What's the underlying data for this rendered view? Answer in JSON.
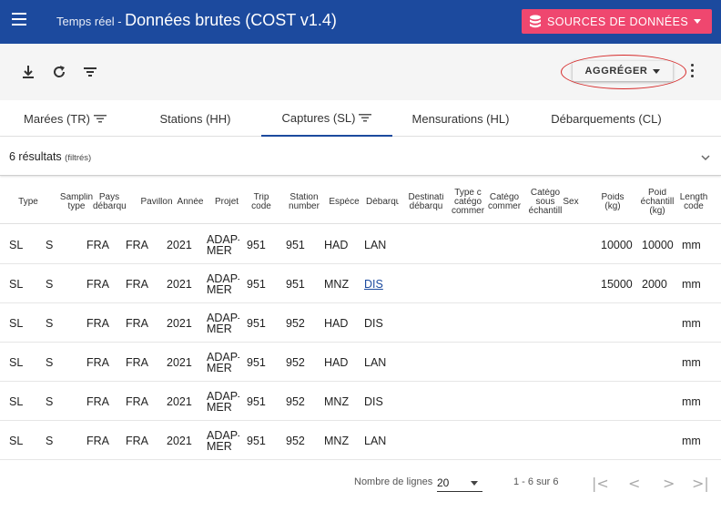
{
  "header": {
    "subtitle": "Temps réel -",
    "title": "Données brutes (COST v1.4)",
    "sources_label": "SOURCES DE DONNÉES",
    "accent": "#1c4a9e",
    "sources_color": "#ef476f"
  },
  "toolbar": {
    "icons": [
      "download-icon",
      "refresh-icon",
      "filter-icon"
    ],
    "aggregate_label": "AGGRÉGER",
    "more_icon": "more-vert-icon"
  },
  "tabs": [
    {
      "label": "Marées (TR)",
      "filtered": true
    },
    {
      "label": "Stations (HH)",
      "filtered": false
    },
    {
      "label": "Captures (SL)",
      "filtered": true,
      "active": true
    },
    {
      "label": "Mensurations (HL)",
      "filtered": false
    },
    {
      "label": "Débarquements (CL)",
      "filtered": false
    }
  ],
  "results": {
    "count": "6 résultats",
    "note": "(filtrés)"
  },
  "table": {
    "headers": [
      "Type",
      "Sampling type",
      "Pays débarque",
      "Pavillon",
      "Année",
      "Projet",
      "Trip code",
      "Station number",
      "Espèce",
      "Débarque",
      "Destinati débarque",
      "Type de catégo commer",
      "Catégo commer",
      "Catégo sous échantill",
      "Sex",
      "Poids (kg)",
      "Poids échantill (kg)",
      "Length code"
    ],
    "rows": [
      [
        "SL",
        "S",
        "FRA",
        "FRA",
        "2021",
        "ADAP-MER",
        "951",
        "951",
        "HAD",
        "LAN",
        "",
        "",
        "",
        "",
        "",
        "10000",
        "10000",
        "mm"
      ],
      [
        "SL",
        "S",
        "FRA",
        "FRA",
        "2021",
        "ADAP-MER",
        "951",
        "951",
        "MNZ",
        "DIS",
        "",
        "",
        "",
        "",
        "",
        "15000",
        "2000",
        "mm"
      ],
      [
        "SL",
        "S",
        "FRA",
        "FRA",
        "2021",
        "ADAP-MER",
        "951",
        "952",
        "HAD",
        "DIS",
        "",
        "",
        "",
        "",
        "",
        "",
        "",
        "mm"
      ],
      [
        "SL",
        "S",
        "FRA",
        "FRA",
        "2021",
        "ADAP-MER",
        "951",
        "952",
        "HAD",
        "LAN",
        "",
        "",
        "",
        "",
        "",
        "",
        "",
        "mm"
      ],
      [
        "SL",
        "S",
        "FRA",
        "FRA",
        "2021",
        "ADAP-MER",
        "951",
        "952",
        "MNZ",
        "DIS",
        "",
        "",
        "",
        "",
        "",
        "",
        "",
        "mm"
      ],
      [
        "SL",
        "S",
        "FRA",
        "FRA",
        "2021",
        "ADAP-MER",
        "951",
        "952",
        "MNZ",
        "LAN",
        "",
        "",
        "",
        "",
        "",
        "",
        "",
        "mm"
      ]
    ],
    "links": [
      [
        1,
        9
      ]
    ]
  },
  "pagination": {
    "rows_label": "Nombre de lignes",
    "rows_value": "20",
    "range": "1 - 6 sur 6",
    "first": "|<",
    "prev": "<",
    "next": ">",
    "last": ">|"
  }
}
